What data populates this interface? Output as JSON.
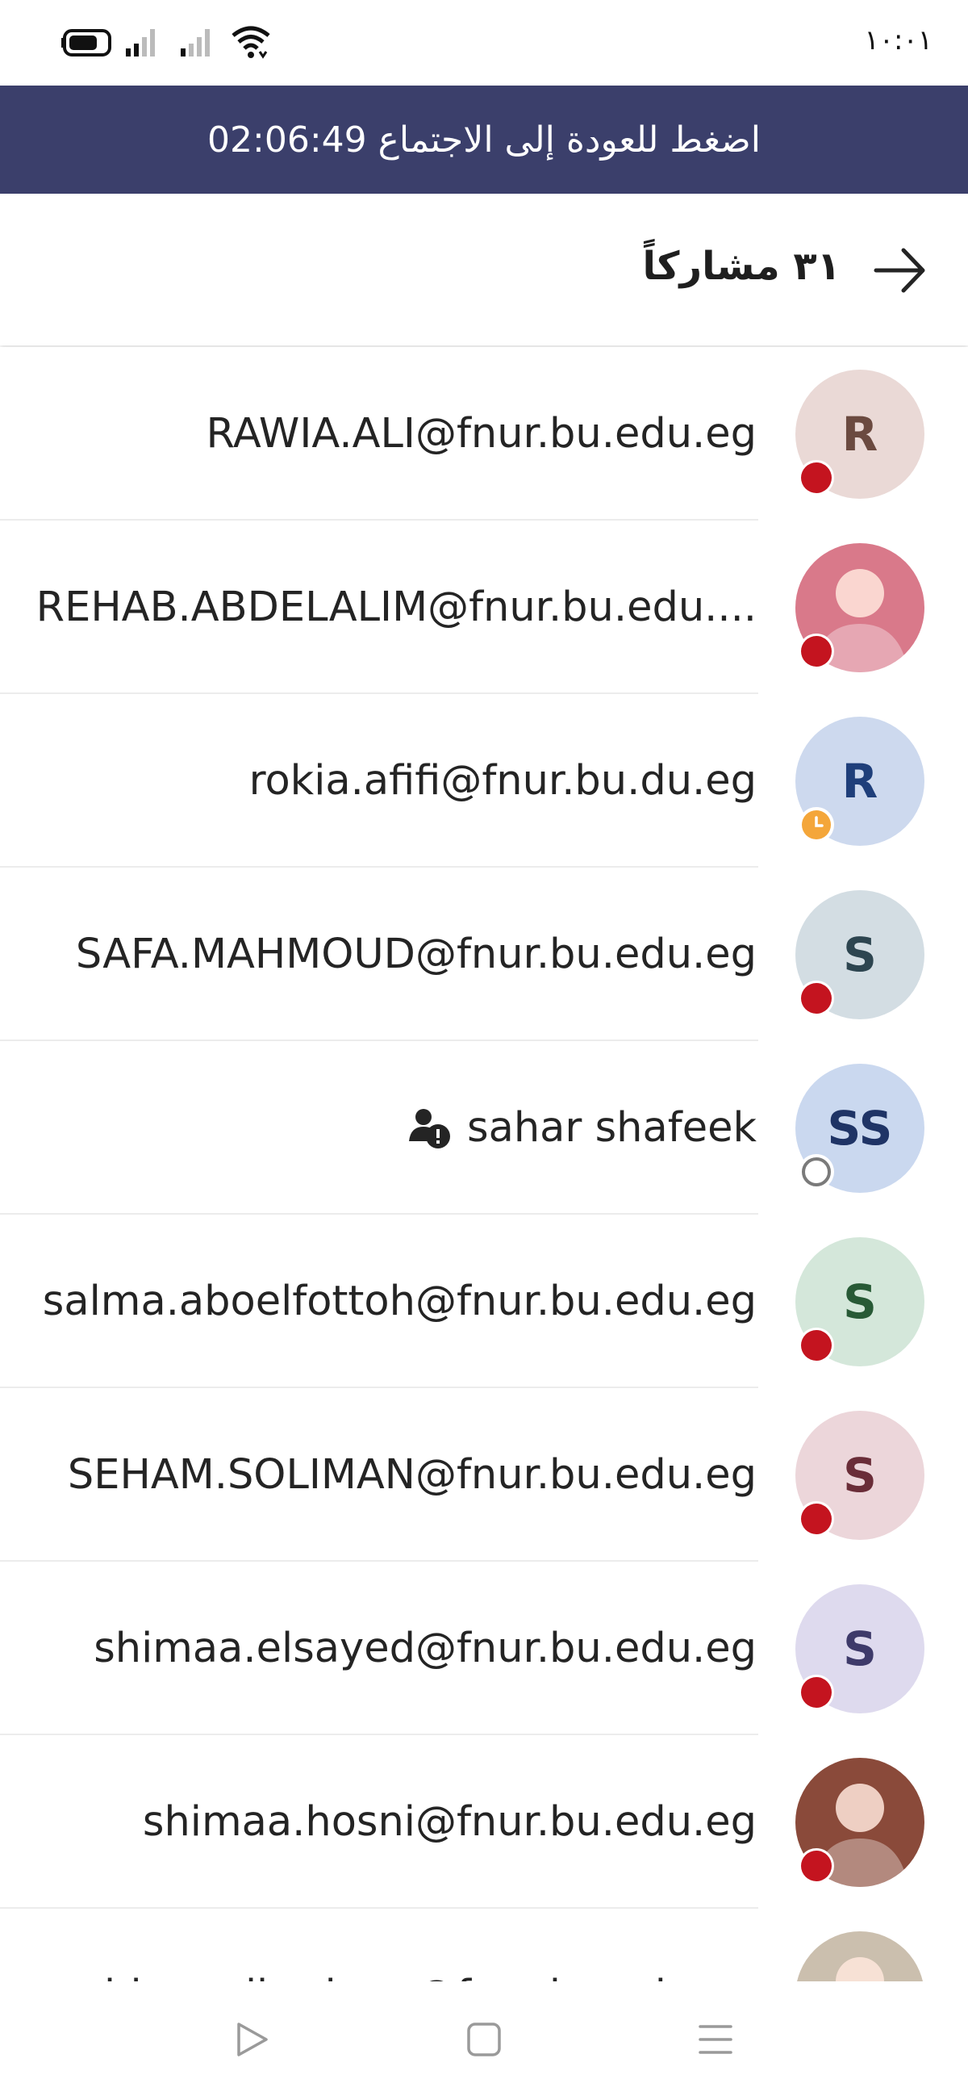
{
  "status_bar": {
    "clock": "١٠:٠١"
  },
  "banner": {
    "text": "اضغط للعودة إلى الاجتماع",
    "time": "02:06:49"
  },
  "header": {
    "title": "٣١ مشاركاً"
  },
  "participants": [
    {
      "name": "RAWIA.ALI@fnur.bu.edu.eg",
      "initials": "R",
      "avatar_bg": "#ead9d6",
      "avatar_fg": "#6b4a40",
      "status": "busy"
    },
    {
      "name": "REHAB.ABDELALIM@fnur.bu.edu....",
      "initials": "",
      "avatar_bg": "#d9798a",
      "avatar_fg": "#ffffff",
      "status": "busy",
      "photo": true
    },
    {
      "name": "rokia.afifi@fnur.bu.du.eg",
      "initials": "R",
      "avatar_bg": "#cdd9ee",
      "avatar_fg": "#1f3f7a",
      "status": "away"
    },
    {
      "name": "SAFA.MAHMOUD@fnur.bu.edu.eg",
      "initials": "S",
      "avatar_bg": "#d3dde3",
      "avatar_fg": "#2d4550",
      "status": "busy"
    },
    {
      "name": "sahar shafeek",
      "initials": "SS",
      "avatar_bg": "#cad8ef",
      "avatar_fg": "#1f3466",
      "status": "offline",
      "guest": true
    },
    {
      "name": "salma.aboelfottoh@fnur.bu.edu.eg",
      "initials": "S",
      "avatar_bg": "#d4e7da",
      "avatar_fg": "#285a36",
      "status": "busy"
    },
    {
      "name": "SEHAM.SOLIMAN@fnur.bu.edu.eg",
      "initials": "S",
      "avatar_bg": "#ecd6da",
      "avatar_fg": "#6a2d38",
      "status": "busy"
    },
    {
      "name": "shimaa.elsayed@fnur.bu.edu.eg",
      "initials": "S",
      "avatar_bg": "#dedaee",
      "avatar_fg": "#3e3a6a",
      "status": "busy"
    },
    {
      "name": "shimaa.hosni@fnur.bu.edu.eg",
      "initials": "",
      "avatar_bg": "#8a4a3a",
      "avatar_fg": "#ffffff",
      "status": "busy",
      "photo": true
    },
    {
      "name": "shimaa.ibrahym@fnur.bu.edu.eg",
      "initials": "",
      "avatar_bg": "#cbbfae",
      "avatar_fg": "#ffffff",
      "status": "busy",
      "photo": true
    }
  ],
  "colors": {
    "banner": "#3b3f6b",
    "busy": "#c4141f",
    "away": "#f4a63a"
  }
}
